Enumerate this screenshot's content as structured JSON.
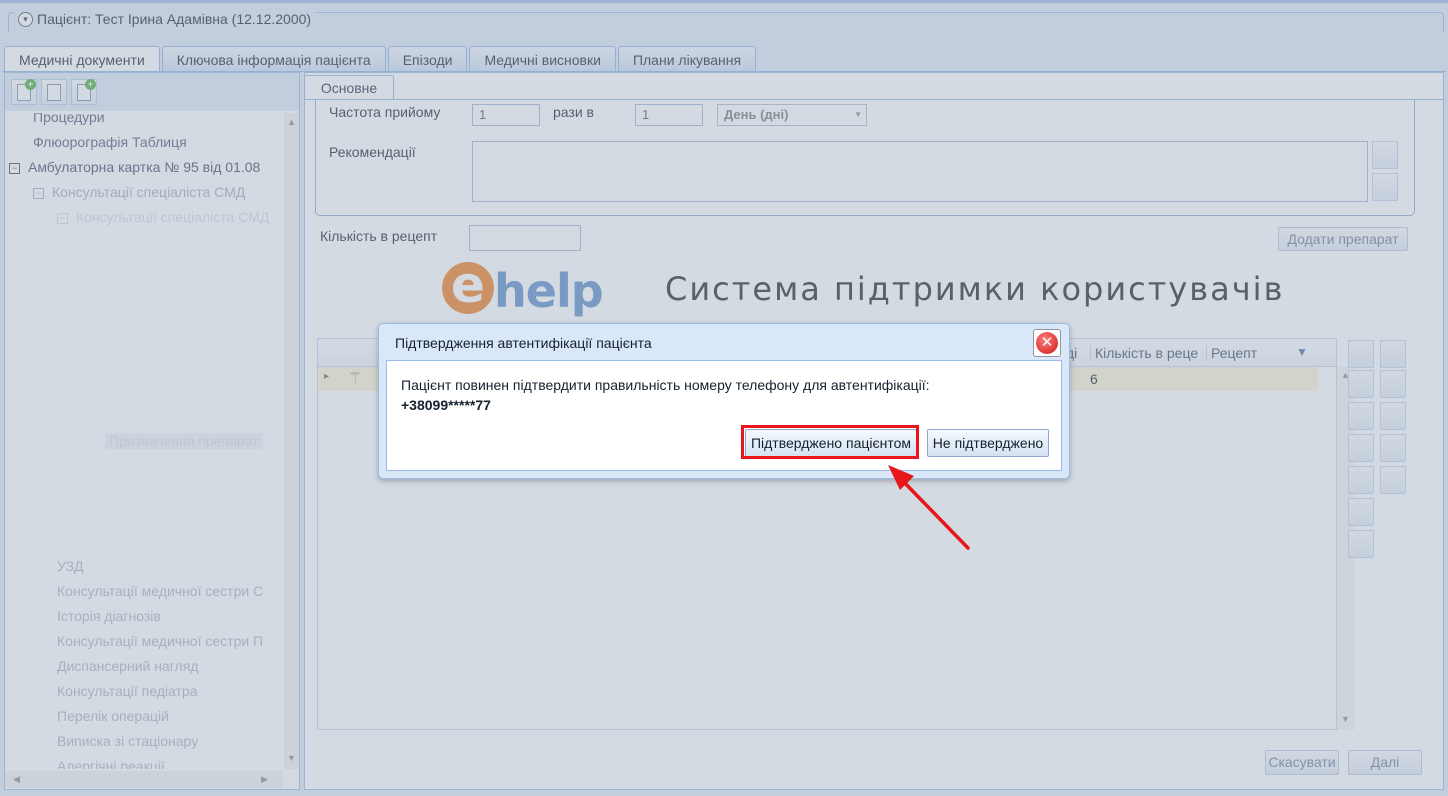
{
  "patient": {
    "label": "Пацієнт: Тест Ірина Адамівна (12.12.2000)",
    "collapse_icon": "chevron-down-icon"
  },
  "tabs": [
    {
      "label": "Медичні документи",
      "active": true
    },
    {
      "label": "Ключова інформація пацієнта",
      "active": false
    },
    {
      "label": "Епізоди",
      "active": false
    },
    {
      "label": "Медичні висновки",
      "active": false
    },
    {
      "label": "Плани лікування",
      "active": false
    }
  ],
  "tree": {
    "items": [
      {
        "label": "Процедури"
      },
      {
        "label": "Флюорографія Таблиця"
      },
      {
        "label": "Амбулаторна картка № 95 від 01.08",
        "expander": "⊟"
      },
      {
        "label": "Консультації спеціаліста СМД",
        "expander": "⊟"
      },
      {
        "label": "Консультації спеціаліста СМД",
        "expander": "⊟"
      },
      {
        "label": "Призначення препарат"
      },
      {
        "label": "УЗД"
      },
      {
        "label": "Консультації медичної сестри С"
      },
      {
        "label": "Історія діагнозів"
      },
      {
        "label": "Консультації медичної сестри П"
      },
      {
        "label": "Диспансерний нагляд"
      },
      {
        "label": "Консультації педіатра"
      },
      {
        "label": "Перелік операцій"
      },
      {
        "label": "Виписка зі стаціонару"
      },
      {
        "label": "Алергічні реакції"
      }
    ]
  },
  "subtab": {
    "label": "Основне"
  },
  "form": {
    "frequency_label": "Частота прийому",
    "frequency_value": "1",
    "times_label": "рази в",
    "times_value": "1",
    "period_value": "День (дні)",
    "recommendations_label": "Рекомендації",
    "recipe_qty_label": "Кількість в рецепт",
    "add_drug_label": "Додати препарат"
  },
  "banner": {
    "logo_e": "e",
    "logo_help": "help",
    "text": "Система підтримки користувачів"
  },
  "grid": {
    "columns": [
      "ді",
      "Кількість в реце",
      "Рецепт"
    ],
    "row_qty": "6"
  },
  "footer": {
    "cancel_label": "Скасувати",
    "next_label": "Далі"
  },
  "dialog": {
    "title": "Підтвердження автентифікації пацієнта",
    "message": "Пацієнт повинен підтвердити правильність номеру телефону для автентифікації:",
    "phone": "+38099*****77",
    "confirm_label": "Підтверджено пацієнтом",
    "reject_label": "Не підтверджено",
    "close_icon": "close-icon"
  },
  "colors": {
    "highlight": "#e8151b",
    "brand_orange": "#ef7d22",
    "brand_blue": "#5a8cc7",
    "panel_border": "#99bbe8"
  }
}
